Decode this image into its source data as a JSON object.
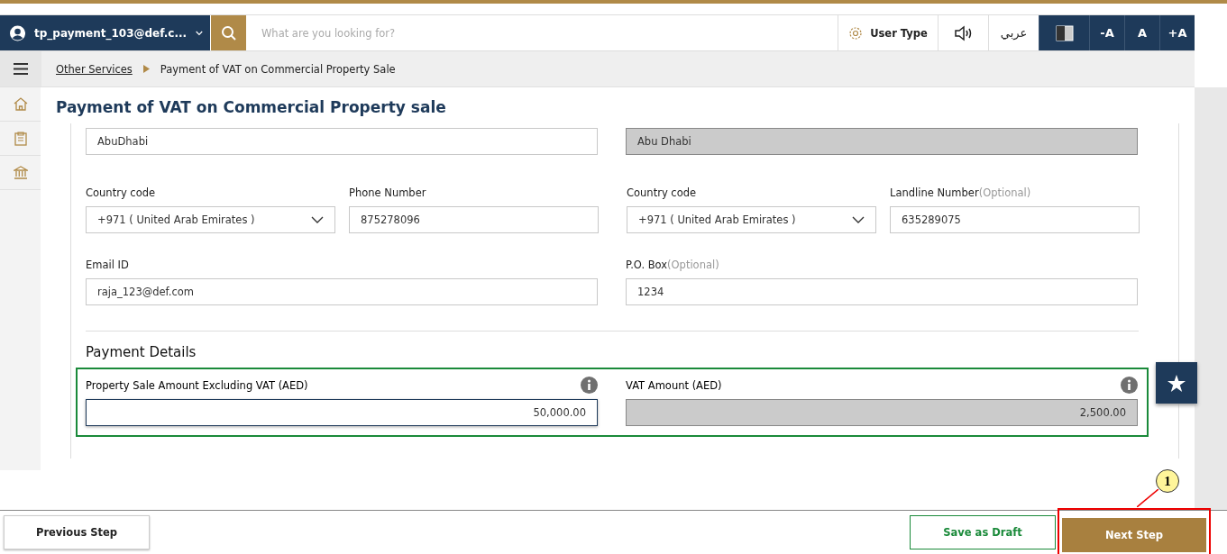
{
  "header": {
    "user": "tp_payment_103@def.c...",
    "search": {
      "placeholder": "What are you looking for?"
    },
    "user_type": "User Type",
    "language": "عربي",
    "font_buttons": [
      "-A",
      "A",
      "+A"
    ]
  },
  "breadcrumb": [
    {
      "label": "Other Services"
    },
    {
      "label": "Payment of VAT on Commercial Property Sale"
    }
  ],
  "title": "Payment of VAT on Commercial Property sale",
  "rows": [
    {
      "kind": "halves",
      "fields": [
        {
          "kind": "text",
          "value": "AbuDhabi",
          "disabled": false
        },
        {
          "kind": "text",
          "value": "Abu Dhabi",
          "disabled": true
        }
      ]
    },
    {
      "kind": "quarters",
      "fields": [
        {
          "kind": "select",
          "label": "Country code",
          "value": "+971 ( United Arab Emirates )"
        },
        {
          "kind": "text",
          "label": "Phone Number",
          "value": "875278096",
          "disabled": false
        },
        {
          "kind": "select",
          "label": "Country code",
          "value": "+971 ( United Arab Emirates )"
        },
        {
          "kind": "text",
          "label": "Landline Number",
          "optional": "(Optional)",
          "value": "635289075",
          "disabled": false
        }
      ]
    },
    {
      "kind": "halves",
      "fields": [
        {
          "kind": "text",
          "label": "Email ID",
          "value": "raja_123@def.com",
          "disabled": false
        },
        {
          "kind": "text",
          "label": "P.O. Box",
          "optional": "(Optional)",
          "value": "1234",
          "disabled": false
        }
      ]
    }
  ],
  "payment": {
    "heading": "Payment Details",
    "fields": [
      {
        "label": "Property Sale Amount Excluding VAT (AED)",
        "value": "50,000.00",
        "disabled": false,
        "focused": true
      },
      {
        "label": "VAT Amount (AED)",
        "value": "2,500.00",
        "disabled": true,
        "focused": false
      }
    ]
  },
  "footer": {
    "previous": "Previous Step",
    "draft": "Save as Draft",
    "next": "Next Step"
  },
  "annotation": "1"
}
